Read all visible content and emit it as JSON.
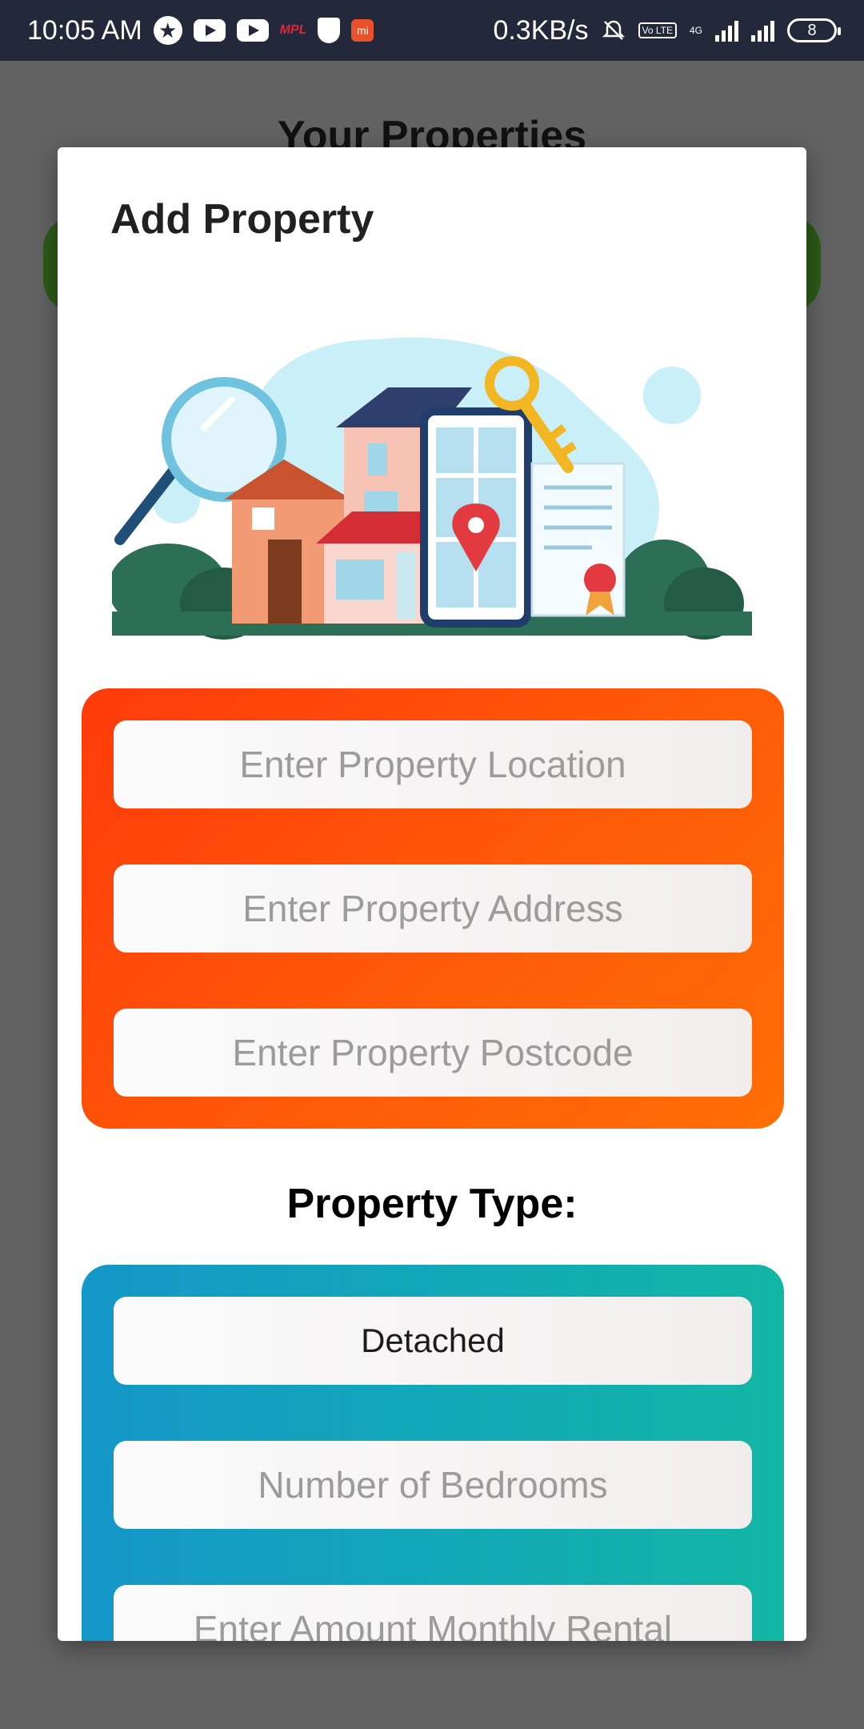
{
  "status_bar": {
    "time": "10:05 AM",
    "net_speed": "0.3KB/s",
    "mpl_label": "MPL",
    "mi_label": "mi",
    "volte_label": "Vo LTE",
    "network_label": "4G",
    "battery_level": "8"
  },
  "background_page": {
    "title": "Your Properties"
  },
  "dialog": {
    "title": "Add Property",
    "location_form": {
      "location_placeholder": "Enter Property Location",
      "address_placeholder": "Enter Property Address",
      "postcode_placeholder": "Enter Property Postcode"
    },
    "property_type_label": "Property Type:",
    "details_form": {
      "property_type_value": "Detached",
      "bedrooms_placeholder": "Number of Bedrooms",
      "rental_placeholder": "Enter Amount Monthly Rental"
    }
  },
  "colors": {
    "orange_panel": "#ff4a08",
    "teal_panel": "#12a9b6",
    "status_bar": "#23283a"
  }
}
